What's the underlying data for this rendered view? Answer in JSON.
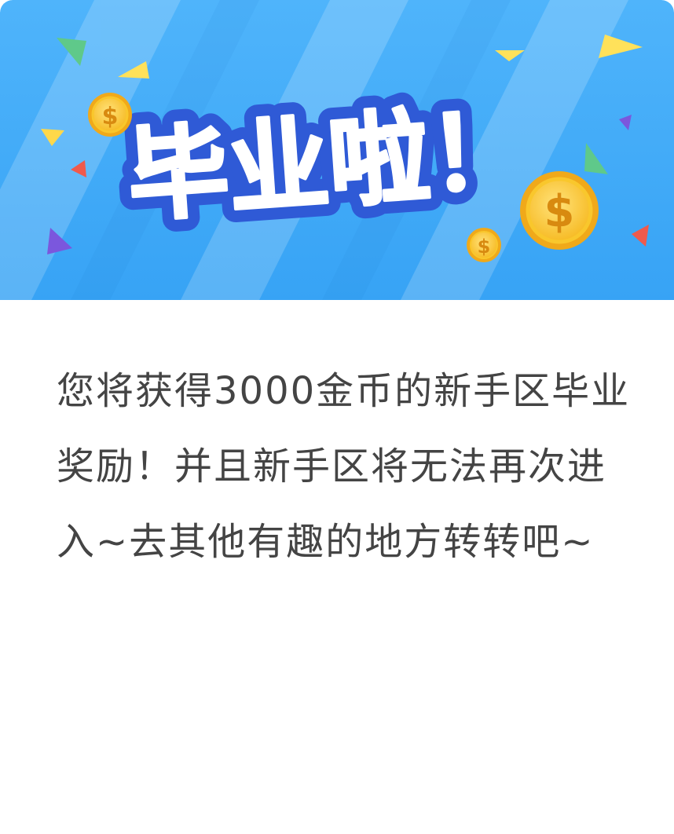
{
  "banner": {
    "headline": "毕业啦！",
    "coin_symbol": "$",
    "colors": {
      "sky_light": "#55b6fb",
      "sky_dark": "#3a9cf2",
      "title_outline": "#2f5ad6",
      "coin_gold": "#f9c72c",
      "coin_rim": "#f0a91a"
    },
    "icons": [
      "coin-icon",
      "confetti-triangle-icon"
    ]
  },
  "dialog": {
    "message": "您将获得3000金币的新手区毕业奖励！并且新手区将无法再次进入~去其他有趣的地方转转吧~"
  }
}
